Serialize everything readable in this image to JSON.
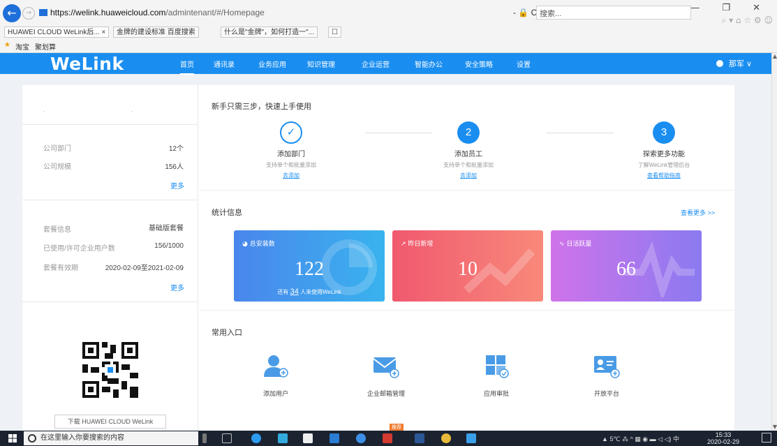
{
  "browser": {
    "url_host": "https://welink.huaweicloud.com",
    "url_path": "/admintenant/#/Homepage",
    "address_controls": "- 🔒 C",
    "search_placeholder": "搜索...",
    "window_controls": "— ❐ ✕",
    "toolbar_icons": "⌕ ▾ ⌂ ☆ ⚙ ☺",
    "tabs": [
      {
        "label": "HUAWEI CLOUD WeLink后... ×"
      },
      {
        "label": "金牌的建设标准 百度搜索"
      },
      {
        "label": "什么是\"金牌\"，如何打造一\"..."
      },
      {
        "label": "☐"
      }
    ],
    "favorites": [
      "淘宝",
      "聚划算"
    ]
  },
  "app": {
    "logo": "WeLink",
    "nav": [
      {
        "label": "首页"
      },
      {
        "label": "通讯录"
      },
      {
        "label": "业务应用"
      },
      {
        "label": "知识管理"
      },
      {
        "label": "企业运营"
      },
      {
        "label": "智能办公"
      },
      {
        "label": "安全策略"
      },
      {
        "label": "设置"
      }
    ],
    "user_name": "那军 ∨"
  },
  "left": {
    "company_title": ". .",
    "dept_label": "公司部门",
    "dept_value": "12个",
    "size_label": "公司规模",
    "size_value": "156人",
    "more1": "更多",
    "plan_label": "套餐信息",
    "plan_value": "基础版套餐",
    "users_label": "已使用/许可企业用户数",
    "users_value": "156/1000",
    "period_label": "套餐有效期",
    "period_value": "2020-02-09至2021-02-09",
    "more2": "更多",
    "download_btn": "下载 HUAWEI CLOUD WeLink"
  },
  "onboarding": {
    "title": "新手只需三步，快速上手使用",
    "steps": [
      {
        "icon": "✓",
        "title": "添加部门",
        "desc": "支持单个和批量添加",
        "link": "去添加"
      },
      {
        "icon": "2",
        "title": "添加员工",
        "desc": "支持单个和批量添加",
        "link": "去添加"
      },
      {
        "icon": "3",
        "title": "探索更多功能",
        "desc": "了解WeLink管理后台",
        "link": "查看帮助指南"
      }
    ]
  },
  "stats": {
    "title": "统计信息",
    "more": "查看更多 >>",
    "cards": [
      {
        "label": "总安装数",
        "value": "122",
        "sub_prefix": "还有",
        "sub_count": "34",
        "sub_suffix": "人未使用WeLink"
      },
      {
        "label": "昨日新增",
        "value": "10"
      },
      {
        "label": "日活跃量",
        "value": "66"
      }
    ],
    "colors": {
      "card1": "#4a86ec",
      "card2": "#f0596f",
      "card3": "#b87aee"
    }
  },
  "common": {
    "title": "常用入口",
    "entries": [
      {
        "icon": "add-user-icon",
        "label": "添加用户"
      },
      {
        "icon": "mail-icon",
        "label": "企业邮箱管理"
      },
      {
        "icon": "app-approval-icon",
        "label": "应用审批"
      },
      {
        "icon": "open-platform-icon",
        "label": "开放平台"
      }
    ]
  },
  "taskbar": {
    "search_placeholder": "在这里输入你要搜索的内容",
    "tray": "▲ 5℃  ⁂  ^ ▦ ◉ ▬ ◁ ◁) 中",
    "time": "15:33",
    "date": "2020-02-29",
    "badge": "推荐"
  },
  "accent": "#1a8ef0"
}
